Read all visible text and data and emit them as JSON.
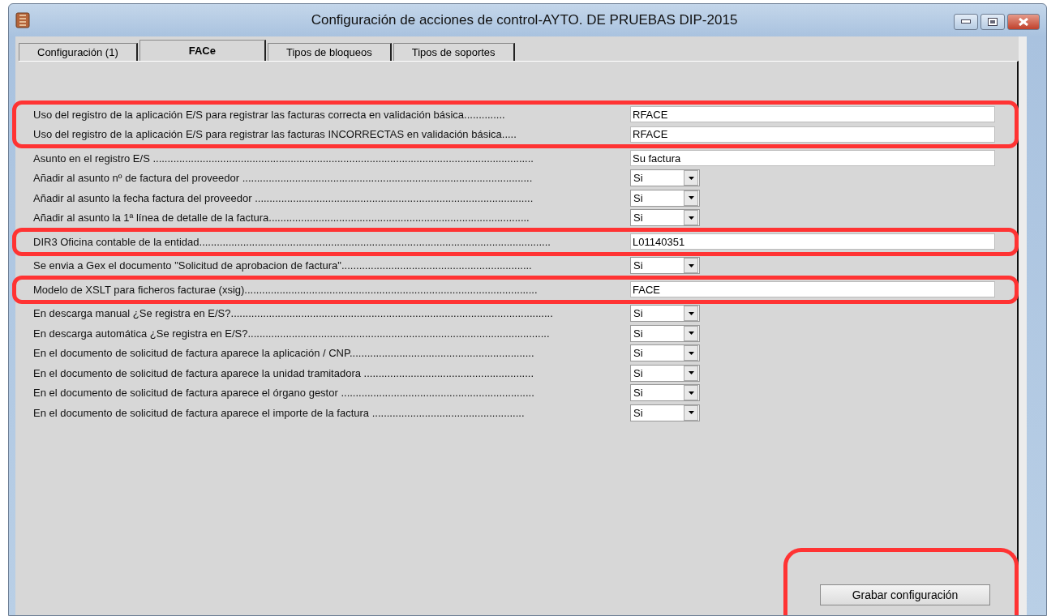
{
  "window": {
    "title": "Configuración de acciones de control-AYTO. DE PRUEBAS DIP-2015"
  },
  "tabs": [
    {
      "label": "Configuración (1)",
      "selected": false
    },
    {
      "label": "FACe",
      "selected": true
    },
    {
      "label": "Tipos de bloqueos",
      "selected": false
    },
    {
      "label": "Tipos de soportes",
      "selected": false
    }
  ],
  "rows": [
    {
      "label": "Uso del registro de la aplicación E/S para registrar las facturas correcta en validación básica..............",
      "kind": "text",
      "value": "RFACE",
      "highlighted": true
    },
    {
      "label": "Uso del registro de la aplicación E/S para registrar las facturas INCORRECTAS en validación básica.....",
      "kind": "text",
      "value": "RFACE",
      "highlighted": true
    },
    {
      "label": "Asunto en el registro E/S ..................................................................................................................................",
      "kind": "text",
      "value": "Su factura",
      "highlighted": false
    },
    {
      "label": "Añadir al asunto nº de factura del proveedor ...................................................................................................",
      "kind": "select",
      "value": "Si",
      "highlighted": false
    },
    {
      "label": "Añadir al asunto la fecha factura del proveedor ...............................................................................................",
      "kind": "select",
      "value": "Si",
      "highlighted": false
    },
    {
      "label": "Añadir al asunto la 1ª línea de detalle de la factura.........................................................................................",
      "kind": "select",
      "value": "Si",
      "highlighted": false
    },
    {
      "label": "DIR3 Oficina contable de la entidad........................................................................................................................",
      "kind": "text",
      "value": "L01140351",
      "highlighted": true
    },
    {
      "label": "Se envia a Gex el documento \"Solicitud de aprobacion de factura\".................................................................",
      "kind": "select",
      "value": "Si",
      "highlighted": false
    },
    {
      "label": "Modelo de XSLT para ficheros facturae (xsig)....................................................................................................",
      "kind": "text",
      "value": "FACE",
      "highlighted": true
    },
    {
      "label": "En descarga manual ¿Se registra en E/S?..............................................................................................................",
      "kind": "select",
      "value": "Si",
      "highlighted": false
    },
    {
      "label": "En descarga automática ¿Se registra en E/S?.......................................................................................................",
      "kind": "select",
      "value": "Si",
      "highlighted": false
    },
    {
      "label": "En el documento de solicitud de factura aparece la aplicación / CNP...............................................................",
      "kind": "select",
      "value": "Si",
      "highlighted": false
    },
    {
      "label": "En el documento de solicitud de factura aparece la unidad tramitadora ..........................................................",
      "kind": "select",
      "value": "Si",
      "highlighted": false
    },
    {
      "label": "En el documento de solicitud de factura aparece el órgano gestor  ..................................................................",
      "kind": "select",
      "value": "Si",
      "highlighted": false
    },
    {
      "label": "En el documento de solicitud de factura aparece el importe de la factura ....................................................",
      "kind": "select",
      "value": "Si",
      "highlighted": false
    }
  ],
  "save_button": {
    "label": "Grabar configuración",
    "highlighted": true
  }
}
